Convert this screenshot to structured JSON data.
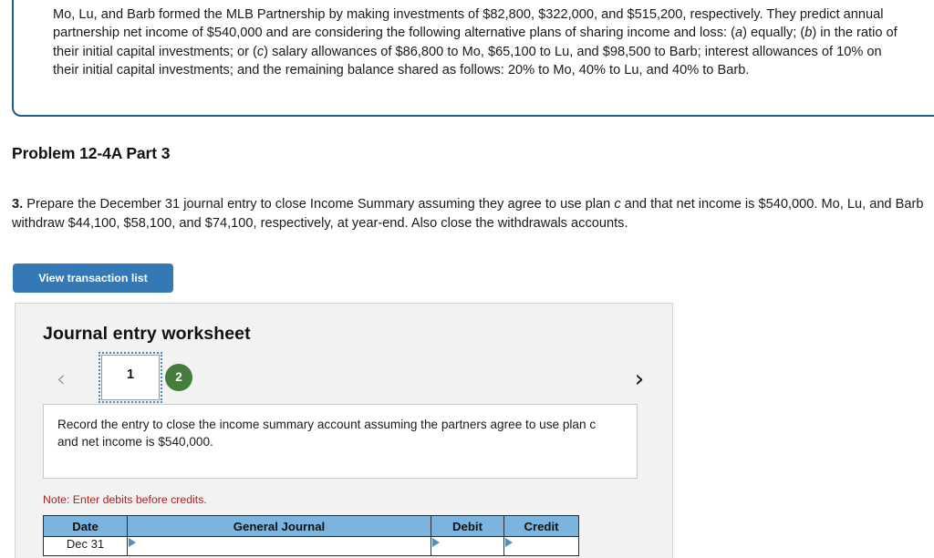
{
  "problem": {
    "statement_parts": [
      "Mo, Lu, and Barb formed the MLB Partnership by making investments of $82,800, $322,000, and $515,200, respectively. They predict annual partnership net income of $540,000 and are considering the following alternative plans of sharing income and loss: (",
      "a",
      ") equally; (",
      "b",
      ") in the ratio of their initial capital investments; or (",
      "c",
      ") salary allowances of $86,800 to Mo, $65,100 to Lu, and $98,500 to Barb; interest allowances of 10% on their initial capital investments; and the remaining balance shared as follows: 20% to Mo, 40% to Lu, and 40% to Barb."
    ],
    "statement_full": "Mo, Lu, and Barb formed the MLB Partnership by making investments of $82,800, $322,000, and $515,200, respectively. They predict annual partnership net income of $540,000 and are considering the following alternative plans of sharing income and loss: (a) equally; (b) in the ratio of their initial capital investments; or (c) salary allowances of $86,800 to Mo, $65,100 to Lu, and $98,500 to Barb; interest allowances of 10% on their initial capital investments; and the remaining balance shared as follows: 20% to Mo, 40% to Lu, and 40% to Barb."
  },
  "part_heading": "Problem 12-4A Part 3",
  "requirement": {
    "number": "3.",
    "text_a": " Prepare the December 31 journal entry to close Income Summary assuming they agree to use plan ",
    "plan": "c",
    "text_b": " and that net income is $540,000. Mo, Lu, and Barb withdraw $44,100, $58,100, and $74,100, respectively, at year-end. Also close the withdrawals accounts."
  },
  "toolbar": {
    "view_transaction_list_label": "View transaction list"
  },
  "worksheet": {
    "title": "Journal entry worksheet",
    "nav": {
      "prev_icon": "chevron-left-icon",
      "next_icon": "chevron-right-icon",
      "prev_glyph": "‹",
      "next_glyph": "›"
    },
    "tabs": [
      {
        "label": "1",
        "state": "selected"
      },
      {
        "label": "2",
        "state": "completed"
      }
    ],
    "entry_instruction": "Record the entry to close the income summary account assuming the partners agree to use plan c and net income is $540,000.",
    "note": "Note: Enter debits before credits.",
    "table": {
      "headers": [
        "Date",
        "General Journal",
        "Debit",
        "Credit"
      ],
      "rows": [
        {
          "date": "Dec 31",
          "general_journal": "",
          "debit": "",
          "credit": ""
        }
      ]
    }
  },
  "colors": {
    "problem_box_border": "#1b5d8f",
    "button_blue": "#3479b5",
    "table_header_blue": "#7cb4e0",
    "tab_green": "#467d3e",
    "note_red": "#b32020",
    "panel_gray": "#f2f2f2",
    "marker_blue": "#4f8fc4"
  }
}
